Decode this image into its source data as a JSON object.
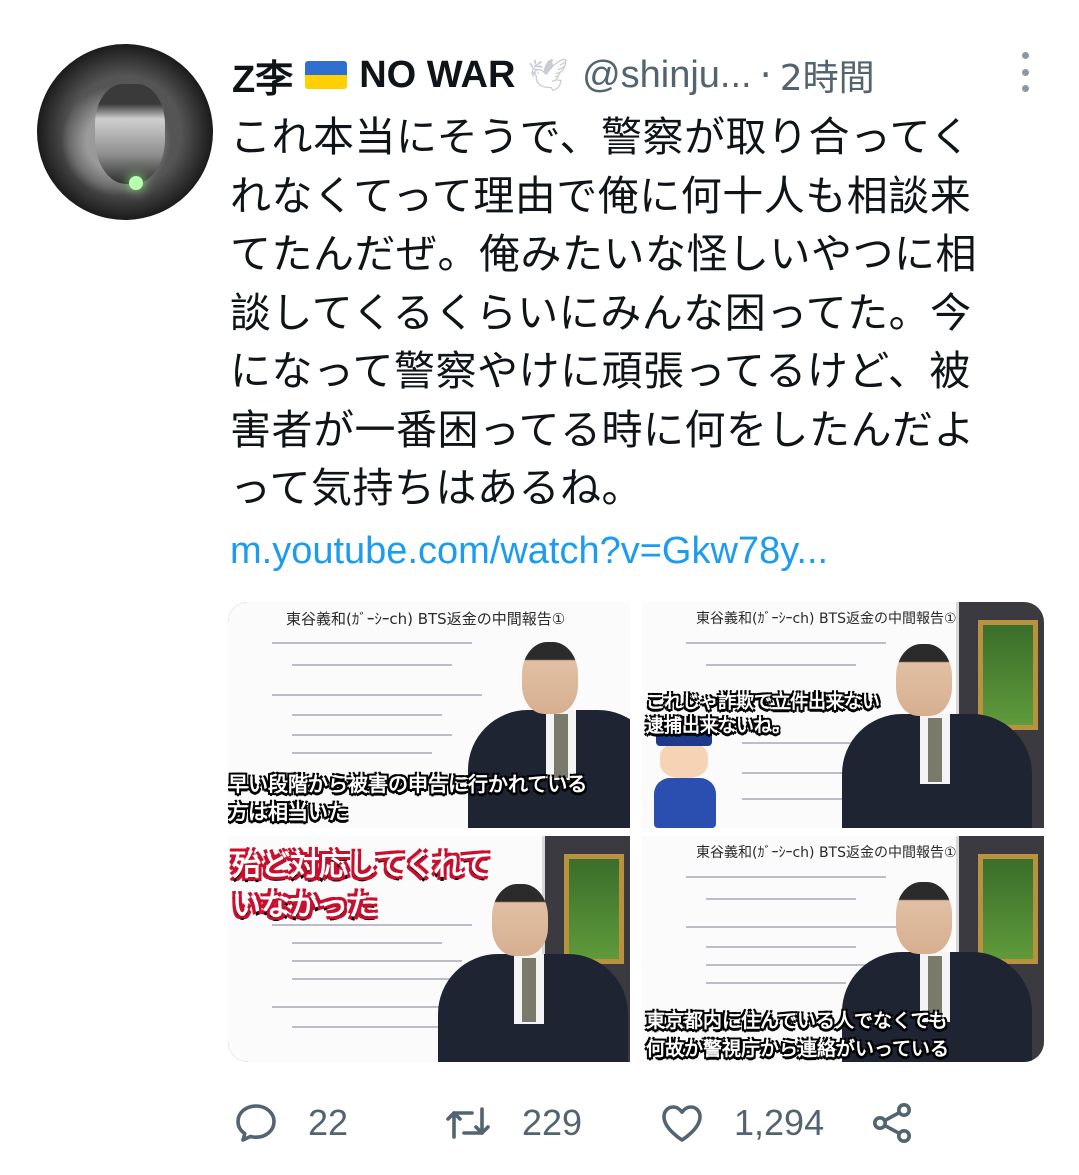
{
  "tweet": {
    "author_name": "Z李",
    "author_name_suffix": "NO WAR",
    "handle": "@shinju...",
    "separator": "·",
    "time": "2時間",
    "body_lines": [
      "これ本当にそうで、警察が取り合ってく",
      "れなくてって理由で俺に何十人も相談来",
      "てたんだぜ。俺みたいな怪しいやつに相",
      "談してくるくらいにみんな困ってた。今",
      "になって警察やけに頑張ってるけど、被",
      "害者が一番困ってる時に何をしたんだよ",
      "って気持ちはあるね。"
    ],
    "link": "m.youtube.com/watch?v=Gkw78y..."
  },
  "media": {
    "thumbs": [
      {
        "board_title": "東谷義和(ｶﾞｰｼｰch) BTS返金の中間報告①",
        "caption_lines": [
          "早い段階から被害の申告に行かれている",
          "方は相当いた"
        ]
      },
      {
        "board_title": "東谷義和(ｶﾞｰｼｰch) BTS返金の中間報告①",
        "caption_lines": [
          "これじゃ詐欺で立件出来ない",
          "逮捕出来ないね。"
        ]
      },
      {
        "board_title": "",
        "caption_lines": [
          "殆ど対応してくれて",
          "いなかった"
        ]
      },
      {
        "board_title": "東谷義和(ｶﾞｰｼｰch) BTS返金の中間報告①",
        "caption_lines": [
          "東京都内に住んでいる人でなくても",
          "何故か警視庁から連絡がいっている"
        ]
      }
    ]
  },
  "actions": {
    "reply_count": "22",
    "retweet_count": "229",
    "like_count": "1,294"
  },
  "icons": {
    "flag": "ukraine-flag-icon",
    "dove": "dove-icon",
    "more": "more-vertical-icon",
    "reply": "reply-icon",
    "retweet": "retweet-icon",
    "like": "heart-icon",
    "share": "share-icon"
  },
  "colors": {
    "text": "#0f1419",
    "secondary": "#536471",
    "link": "#1d9bf0"
  }
}
